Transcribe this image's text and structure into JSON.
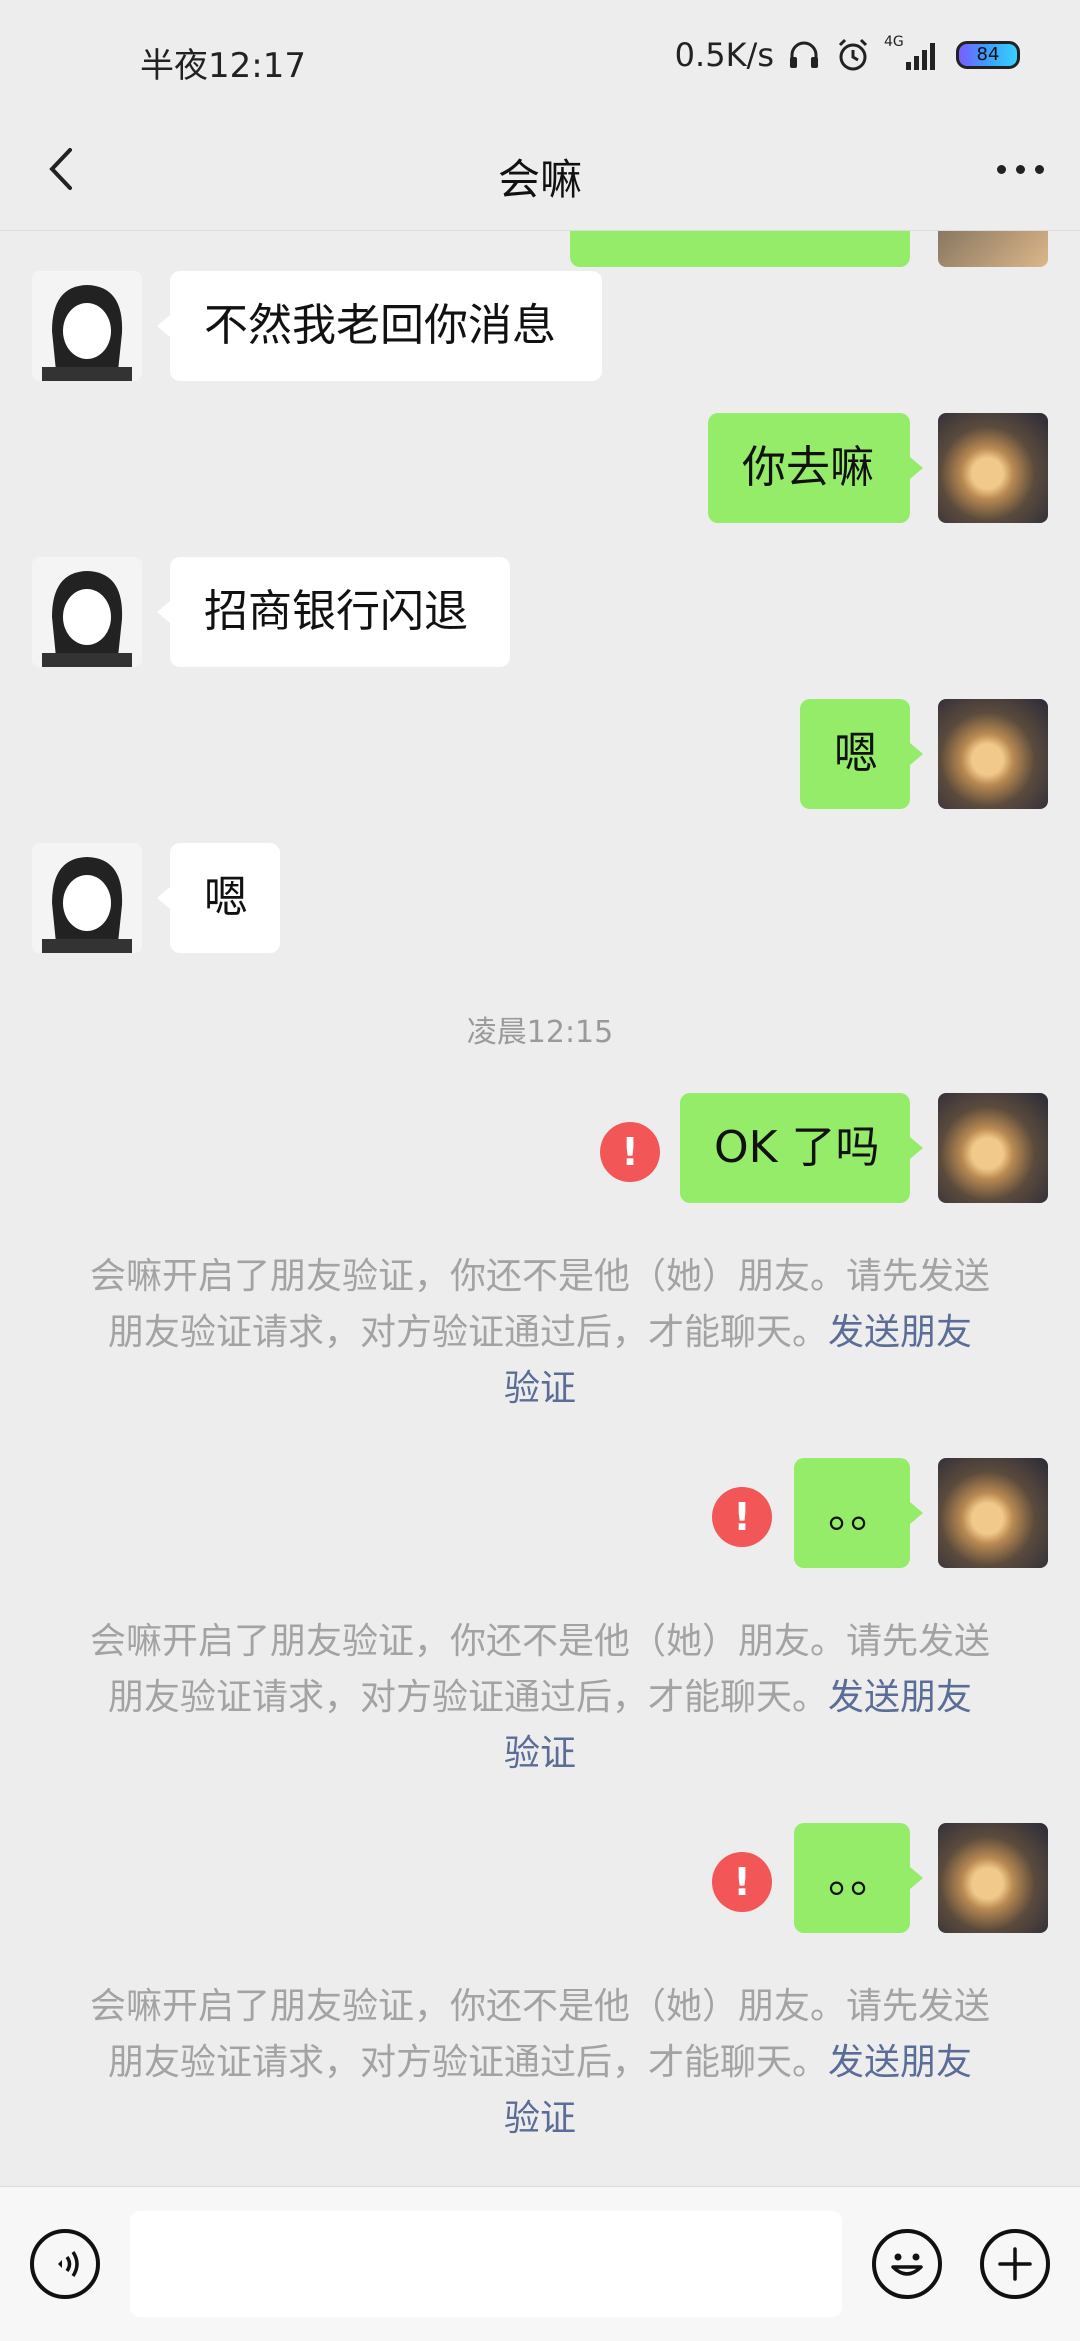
{
  "status_bar": {
    "time": "半夜12:17",
    "net_speed": "0.5K/s",
    "signal_label": "4G",
    "battery": "84"
  },
  "nav": {
    "title": "会嘛"
  },
  "messages": [
    {
      "side": "left",
      "text": "不然我老回你消息"
    },
    {
      "side": "right",
      "text": "你去嘛"
    },
    {
      "side": "left",
      "text": "招商银行闪退"
    },
    {
      "side": "right",
      "text": "嗯"
    },
    {
      "side": "left",
      "text": "嗯"
    },
    {
      "type": "timestamp",
      "text": "凌晨12:15"
    },
    {
      "side": "right",
      "text": "OK 了吗",
      "failed": true
    },
    {
      "type": "system",
      "text": "会嘛开启了朋友验证，你还不是他（她）朋友。请先发送朋友验证请求，对方验证通过后，才能聊天。",
      "link": "发送朋友验证"
    },
    {
      "side": "right",
      "text": "。。",
      "failed": true
    },
    {
      "type": "system",
      "text": "会嘛开启了朋友验证，你还不是他（她）朋友。请先发送朋友验证请求，对方验证通过后，才能聊天。",
      "link": "发送朋友验证"
    },
    {
      "side": "right",
      "text": "。。",
      "failed": true
    },
    {
      "type": "system",
      "text": "会嘛开启了朋友验证，你还不是他（她）朋友。请先发送朋友验证请求，对方验证通过后，才能聊天。",
      "link": "发送朋友验证"
    }
  ],
  "error_glyph": "!",
  "input_bar": {
    "voice_icon": "voice-icon",
    "emoji_icon": "emoji-icon",
    "plus_icon": "plus-icon",
    "placeholder": ""
  },
  "colors": {
    "bubble_self": "#95ec69",
    "bubble_other": "#ffffff",
    "error": "#f25656",
    "link": "#5a6d97"
  }
}
